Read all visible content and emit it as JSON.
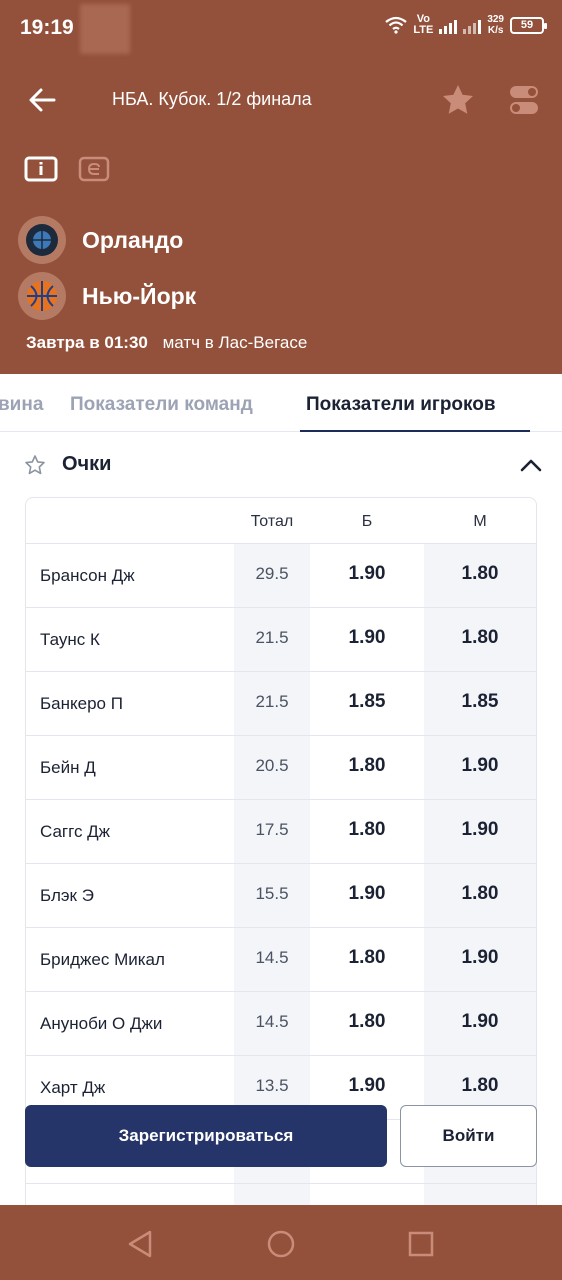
{
  "status_bar": {
    "time": "19:19",
    "network_vo": "Vo",
    "network_lte": "LTE",
    "speed_value": "329",
    "speed_unit": "K/s",
    "battery": "59"
  },
  "header": {
    "title": "НБА. Кубок. 1/2 финала"
  },
  "match": {
    "team1": "Орландо",
    "team2": "Нью-Йорк",
    "date": "Завтра в 01:30",
    "venue": "матч в Лас-Вегасе"
  },
  "tabs": [
    {
      "label": "вина"
    },
    {
      "label": "Показатели команд"
    },
    {
      "label": "Показатели игроков"
    }
  ],
  "section": {
    "title": "Очки"
  },
  "table": {
    "headers": {
      "total": "Тотал",
      "over": "Б",
      "under": "М"
    },
    "rows": [
      {
        "name": "Брансон Дж",
        "total": "29.5",
        "over": "1.90",
        "under": "1.80"
      },
      {
        "name": "Таунс К",
        "total": "21.5",
        "over": "1.90",
        "under": "1.80"
      },
      {
        "name": "Банкеро П",
        "total": "21.5",
        "over": "1.85",
        "under": "1.85"
      },
      {
        "name": "Бейн Д",
        "total": "20.5",
        "over": "1.80",
        "under": "1.90"
      },
      {
        "name": "Саггс Дж",
        "total": "17.5",
        "over": "1.80",
        "under": "1.90"
      },
      {
        "name": "Блэк Э",
        "total": "15.5",
        "over": "1.90",
        "under": "1.80"
      },
      {
        "name": "Бриджес Микал",
        "total": "14.5",
        "over": "1.80",
        "under": "1.90"
      },
      {
        "name": "Ануноби О Джи",
        "total": "14.5",
        "over": "1.80",
        "under": "1.90"
      },
      {
        "name": "Харт Дж",
        "total": "13.5",
        "over": "1.90",
        "under": "1.80"
      }
    ]
  },
  "actions": {
    "register": "Зарегистрироваться",
    "login": "Войти"
  },
  "colors": {
    "header_bg": "#93503a",
    "primary_button": "#253469",
    "tab_underline": "#1d2b5a"
  }
}
